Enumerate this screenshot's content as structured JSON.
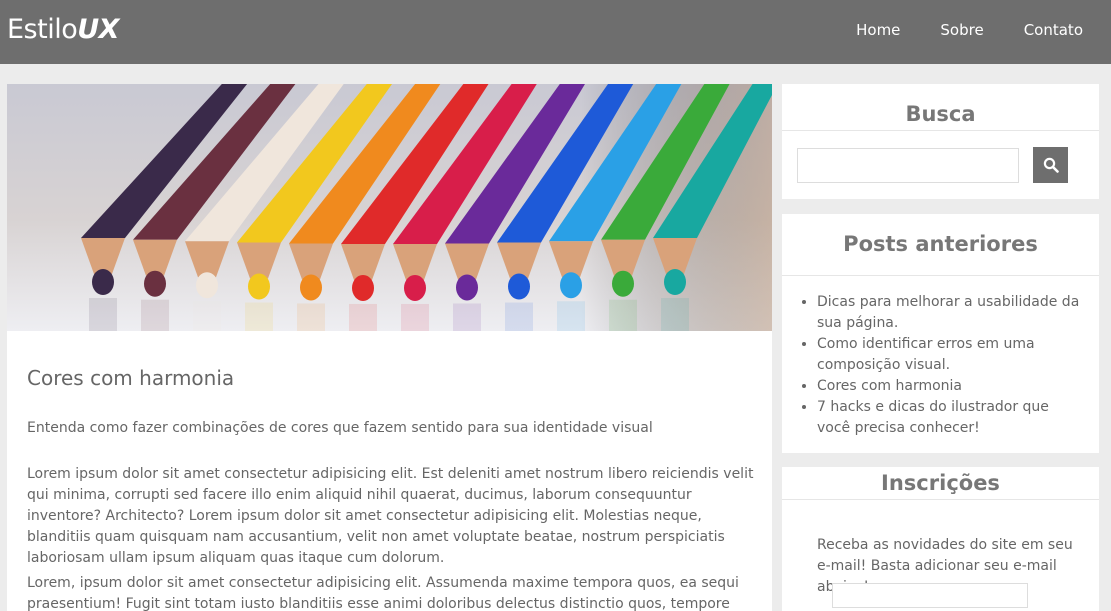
{
  "header": {
    "brand_main": "Estilo",
    "brand_accent": "UX",
    "nav": [
      "Home",
      "Sobre",
      "Contato"
    ]
  },
  "post": {
    "image_alt": "colored pencils",
    "title": "Cores com harmonia",
    "subtitle": "Entenda como fazer combinações de cores que fazem sentido para sua identidade visual",
    "paragraphs": [
      "Lorem ipsum dolor sit amet consectetur adipisicing elit. Est deleniti amet nostrum libero reiciendis velit qui minima, corrupti sed facere illo enim aliquid nihil quaerat, ducimus, laborum consequuntur inventore? Architecto? Lorem ipsum dolor sit amet consectetur adipisicing elit. Molestias neque, blanditiis quam quisquam nam accusantium, velit non amet voluptate beatae, nostrum perspiciatis laboriosam ullam ipsum aliquam quas itaque cum dolorum.",
      "Lorem, ipsum dolor sit amet consectetur adipisicing elit. Assumenda maxime tempora quos, ea sequi praesentium! Fugit sint totam iusto blanditiis esse animi doloribus delectus distinctio quos, tempore molestiae reprehenderit odio!"
    ]
  },
  "sidebar": {
    "search": {
      "title": "Busca",
      "placeholder": "",
      "icon": "search-icon"
    },
    "posts": {
      "title": "Posts anteriores",
      "items": [
        "Dicas para melhorar a usabilidade da sua página.",
        "Como identificar erros em uma composição visual.",
        "Cores com harmonia",
        "7 hacks e dicas do ilustrador que você precisa conhecer!"
      ]
    },
    "subscriptions": {
      "title": "Inscrições",
      "text": "Receba as novidades do site em seu e-mail! Basta adicionar seu e-mail abaixo!",
      "placeholder": ""
    }
  },
  "colors": {
    "header_bg": "#6e6e6e",
    "page_bg": "#ececec",
    "text": "#666666"
  }
}
